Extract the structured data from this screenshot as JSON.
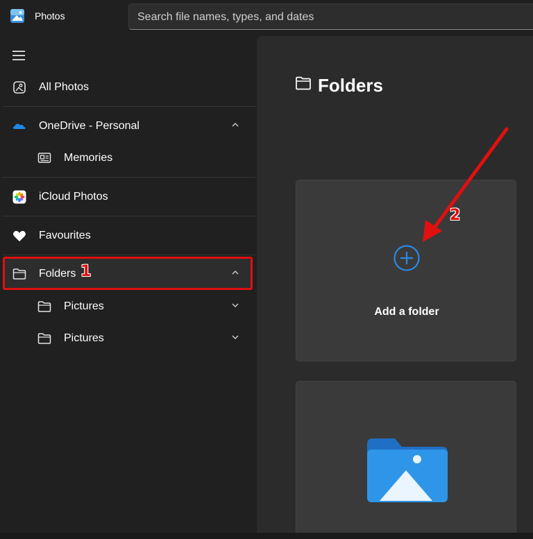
{
  "app": {
    "title": "Photos",
    "icon": "photos-app-icon"
  },
  "search": {
    "placeholder": "Search file names, types, and dates"
  },
  "sidebar": {
    "items": [
      {
        "label": "All Photos",
        "icon": "image-icon"
      },
      {
        "label": "OneDrive - Personal",
        "icon": "cloud-icon",
        "expanded": true
      },
      {
        "label": "Memories",
        "icon": "memories-icon"
      },
      {
        "label": "iCloud Photos",
        "icon": "icloud-photos-icon"
      },
      {
        "label": "Favourites",
        "icon": "heart-icon"
      },
      {
        "label": "Folders",
        "icon": "folder-icon",
        "expanded": true,
        "selected": true
      },
      {
        "label": "Pictures",
        "icon": "folder-icon"
      },
      {
        "label": "Pictures",
        "icon": "folder-icon"
      }
    ]
  },
  "main": {
    "title": "Folders",
    "add_card": {
      "label": "Add a folder"
    }
  },
  "annotations": {
    "step1": "1",
    "step2": "2"
  },
  "colors": {
    "accent": "#2b8ae6",
    "annotation": "#e01010",
    "background": "#202020",
    "panel": "#2b2b2b"
  }
}
